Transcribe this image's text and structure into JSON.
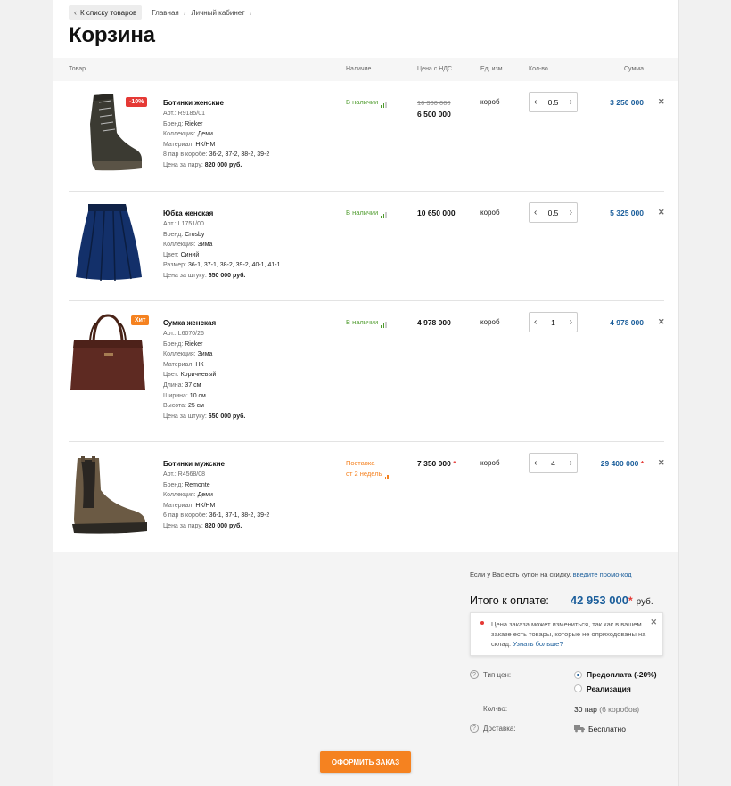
{
  "nav": {
    "back_label": "К списку товаров",
    "breadcrumbs": [
      "Главная",
      "Личный кабинет"
    ]
  },
  "page_title": "Корзина",
  "table_headers": {
    "product": "Товар",
    "availability": "Наличие",
    "price": "Цена с НДС",
    "unit": "Ед. изм.",
    "qty": "Кол-во",
    "sum": "Сумма"
  },
  "items": [
    {
      "name": "Ботинки женские",
      "article": "Арт.: R9185/01",
      "badge": "-10%",
      "details": [
        {
          "label": "Бренд:",
          "value": "Rieker"
        },
        {
          "label": "Коллекция:",
          "value": "Деми"
        },
        {
          "label": "Материал:",
          "value": "НК/НМ"
        },
        {
          "label": "8 пар в коробе:",
          "value": "36-2, 37-2, 38-2, 39-2"
        }
      ],
      "unit_price_label": "Цена за пару:",
      "unit_price_value": "820 000 руб.",
      "availability": "В наличии",
      "old_price": "10 300 000",
      "price": "6 500 000",
      "unit": "короб",
      "qty": "0.5",
      "sum": "3 250 000"
    },
    {
      "name": "Юбка женская",
      "article": "Арт.: L1751/00",
      "details": [
        {
          "label": "Бренд:",
          "value": "Crosby"
        },
        {
          "label": "Коллекция:",
          "value": "Зима"
        },
        {
          "label": "Цвет:",
          "value": "Синий"
        },
        {
          "label": "Размер:",
          "value": "36-1, 37-1, 38-2, 39-2, 40-1, 41-1"
        }
      ],
      "unit_price_label": "Цена за штуку:",
      "unit_price_value": "650 000 руб.",
      "availability": "В наличии",
      "price": "10 650 000",
      "unit": "короб",
      "qty": "0.5",
      "sum": "5 325 000"
    },
    {
      "name": "Сумка женская",
      "article": "Арт.: L6070/26",
      "badge": "Хит",
      "details": [
        {
          "label": "Бренд:",
          "value": "Rieker"
        },
        {
          "label": "Коллекция:",
          "value": "Зима"
        },
        {
          "label": "Материал:",
          "value": "НК"
        },
        {
          "label": "Цвет:",
          "value": "Коричневый"
        },
        {
          "label": "Длина:",
          "value": "37 см"
        },
        {
          "label": "Ширина:",
          "value": "10 см"
        },
        {
          "label": "Высота:",
          "value": "25 см"
        }
      ],
      "unit_price_label": "Цена за штуку:",
      "unit_price_value": "650 000 руб.",
      "availability": "В наличии",
      "price": "4 978 000",
      "unit": "короб",
      "qty": "1",
      "sum": "4 978 000"
    },
    {
      "name": "Ботинки мужские",
      "article": "Арт.: R4568/08",
      "details": [
        {
          "label": "Бренд:",
          "value": "Remonte"
        },
        {
          "label": "Коллекция:",
          "value": "Деми"
        },
        {
          "label": "Материал:",
          "value": "НК/НМ"
        },
        {
          "label": "6 пар в коробе:",
          "value": "36-1, 37-1, 38-2, 39-2"
        }
      ],
      "unit_price_label": "Цена за пару:",
      "unit_price_value": "820 000 руб.",
      "availability_line1": "Поставка",
      "availability_line2": "от 2 недель",
      "price": "7 350 000",
      "unit": "короб",
      "qty": "4",
      "sum": "29 400 000"
    }
  ],
  "summary": {
    "coupon_text": "Если у Вас есть купон на скидку,",
    "coupon_link": "введите промо-код",
    "total_label": "Итого к оплате:",
    "total_amount": "42 953 000",
    "total_currency": "руб.",
    "notice_text": "Цена заказа может измениться, так как в вашем заказе есть товары, которые не оприходованы на склад.",
    "notice_link": "Узнать больше?",
    "price_type_label": "Тип цен:",
    "price_type_options": [
      "Предоплата (-20%)",
      "Реализация"
    ],
    "qty_label": "Кол-во:",
    "qty_value": "30 пар",
    "qty_boxes": "(6 коробов)",
    "delivery_label": "Доставка:",
    "delivery_value": "Бесплатно",
    "order_button": "ОФОРМИТЬ ЗАКАЗ"
  },
  "colors": {
    "accent_blue": "#1b5e9b",
    "accent_orange": "#f58220",
    "in_stock_green": "#4c9a2a",
    "sale_red": "#e53935"
  }
}
